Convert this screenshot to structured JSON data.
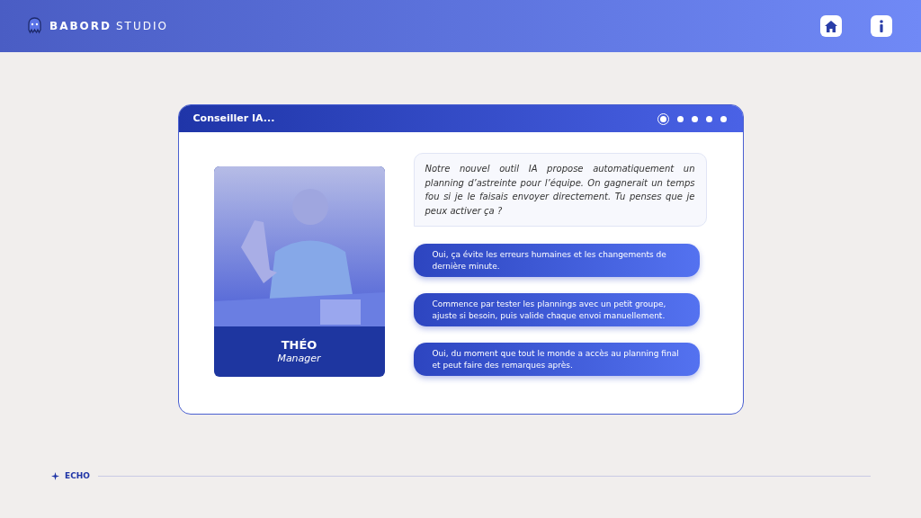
{
  "header": {
    "brand_bold": "BABORD",
    "brand_light": "STUDIO"
  },
  "dialog": {
    "title": "Conseiller IA...",
    "steps": [
      {
        "selected": true
      },
      {
        "selected": false
      },
      {
        "selected": false
      },
      {
        "selected": false
      },
      {
        "selected": false
      }
    ],
    "character": {
      "name": "THÉO",
      "role": "Manager"
    },
    "message": "Notre nouvel outil IA propose automatiquement un planning d’astreinte pour l’équipe. On gagnerait un temps fou si je le faisais envoyer directement. Tu penses que je peux activer ça ?",
    "choices": [
      "Oui, ça évite les erreurs humaines et les changements de dernière minute.",
      "Commence par tester les plannings avec un petit groupe, ajuste si besoin, puis valide chaque envoi manuellement.",
      "Oui, du moment que tout le monde a accès au planning final et peut faire des remarques après."
    ]
  },
  "footer": {
    "label": "ECHO"
  }
}
